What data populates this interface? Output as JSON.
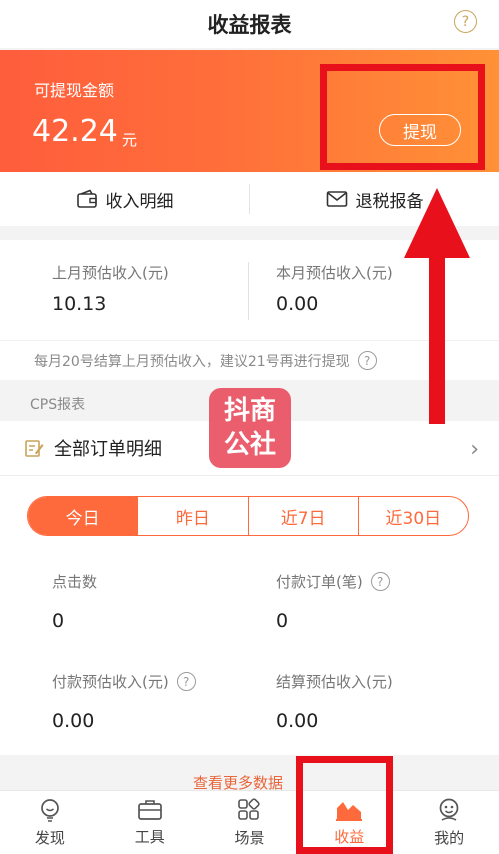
{
  "header": {
    "title": "收益报表",
    "help": "?"
  },
  "banner": {
    "label": "可提现金额",
    "amount": "42.24",
    "unit": "元",
    "withdraw": "提现"
  },
  "subbar": {
    "income_detail": "收入明细",
    "refund_report": "退税报备"
  },
  "estimates": {
    "last_month_label": "上月预估收入(元)",
    "last_month_value": "10.13",
    "this_month_label": "本月预估收入(元)",
    "this_month_value": "0.00",
    "note": "每月20号结算上月预估收入，建议21号再进行提现"
  },
  "cps": {
    "section_label": "CPS报表",
    "orders_label": "全部订单明细",
    "chevron": "›"
  },
  "tabs": [
    "今日",
    "昨日",
    "近7日",
    "近30日"
  ],
  "metrics": {
    "clicks_label": "点击数",
    "clicks_value": "0",
    "paid_orders_label": "付款订单(笔)",
    "paid_orders_value": "0",
    "paid_income_label": "付款预估收入(元)",
    "paid_income_value": "0.00",
    "settled_income_label": "结算预估收入(元)",
    "settled_income_value": "0.00"
  },
  "more_data": "查看更多数据",
  "nav": [
    {
      "label": "发现",
      "icon": "lightbulb-icon"
    },
    {
      "label": "工具",
      "icon": "briefcase-icon"
    },
    {
      "label": "场景",
      "icon": "grid-icon"
    },
    {
      "label": "收益",
      "icon": "chart-icon"
    },
    {
      "label": "我的",
      "icon": "profile-icon"
    }
  ],
  "watermark": {
    "line1": "抖商",
    "line2": "公社"
  },
  "colors": {
    "accent": "#ff6a3d",
    "annotation": "#e8101a"
  }
}
